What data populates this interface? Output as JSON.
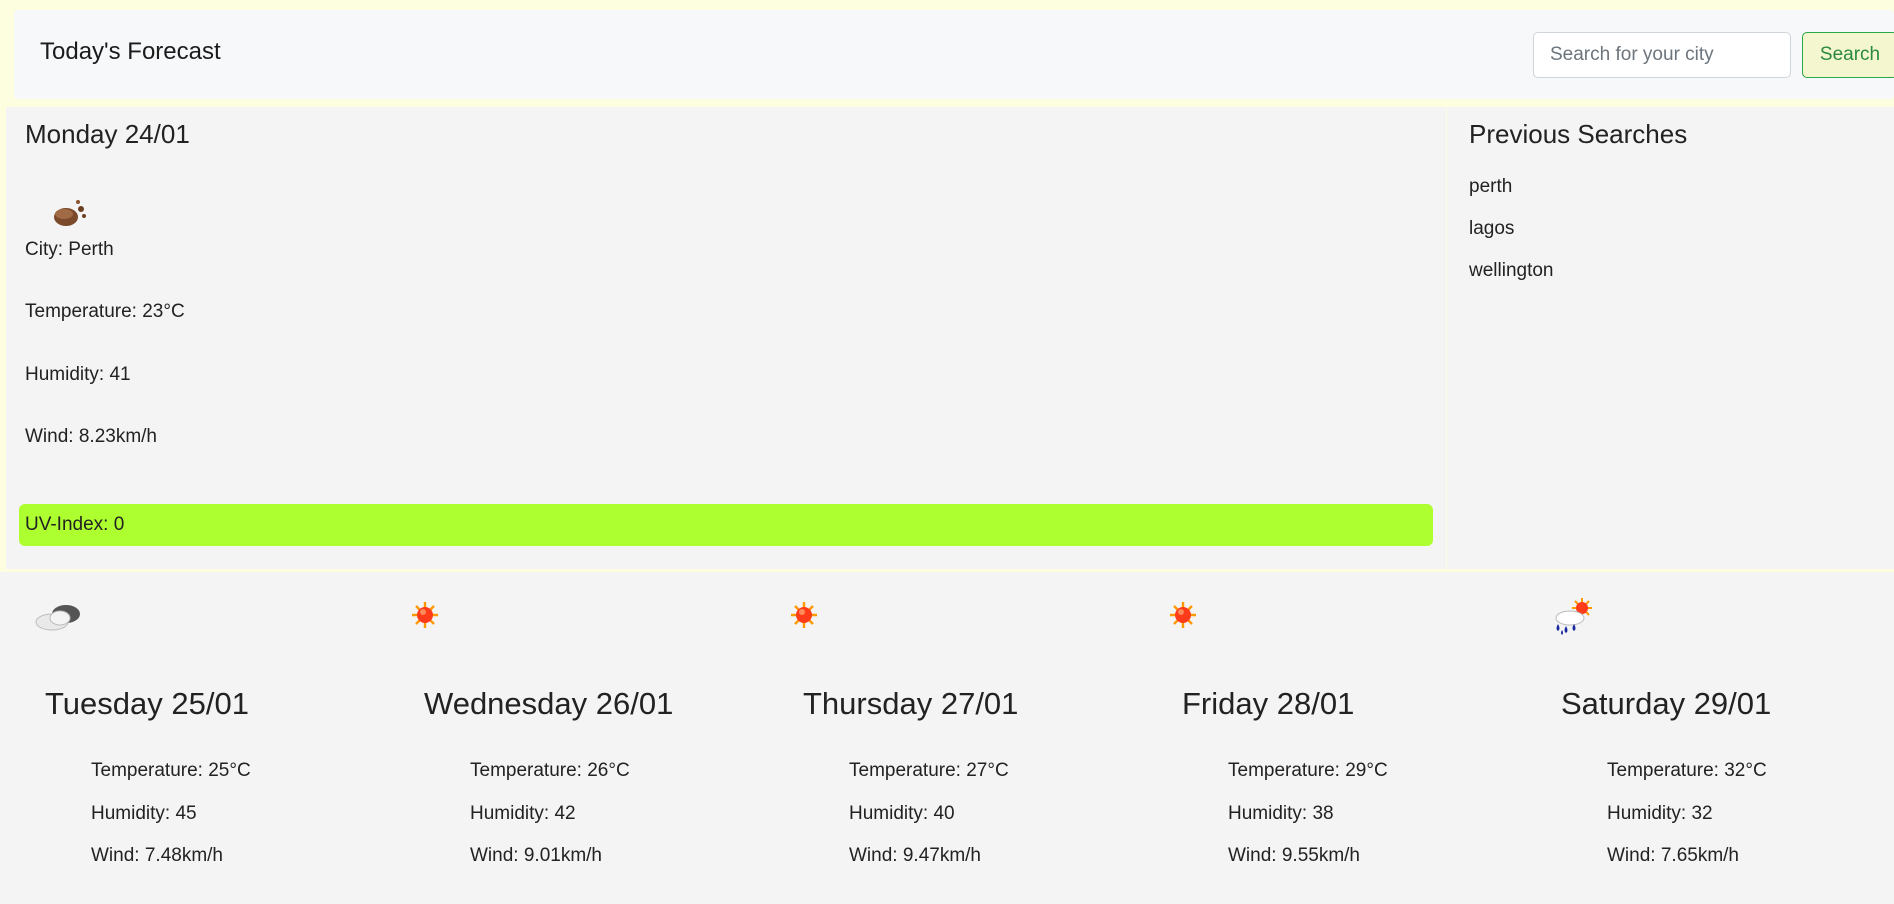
{
  "header": {
    "brand": "Today's Forecast",
    "search_placeholder": "Search for your city",
    "search_button": "Search"
  },
  "today": {
    "date": "Monday 24/01",
    "icon": "dust-weather-icon",
    "city": "City: Perth",
    "temperature": "Temperature: 23°C",
    "humidity": "Humidity: 41",
    "wind": "Wind: 8.23km/h",
    "uv": "UV-Index: 0",
    "uv_color": "#adff2f"
  },
  "previous": {
    "title": "Previous Searches",
    "items": [
      "perth",
      "lagos",
      "wellington"
    ]
  },
  "forecast": [
    {
      "day": "Tuesday 25/01",
      "icon": "cloudy-icon",
      "temperature": "Temperature: 25°C",
      "humidity": "Humidity: 45",
      "wind": "Wind: 7.48km/h"
    },
    {
      "day": "Wednesday 26/01",
      "icon": "sun-icon",
      "temperature": "Temperature: 26°C",
      "humidity": "Humidity: 42",
      "wind": "Wind: 9.01km/h"
    },
    {
      "day": "Thursday 27/01",
      "icon": "sun-icon",
      "temperature": "Temperature: 27°C",
      "humidity": "Humidity: 40",
      "wind": "Wind: 9.47km/h"
    },
    {
      "day": "Friday 28/01",
      "icon": "sun-icon",
      "temperature": "Temperature: 29°C",
      "humidity": "Humidity: 38",
      "wind": "Wind: 9.55km/h"
    },
    {
      "day": "Saturday 29/01",
      "icon": "rain-sun-icon",
      "temperature": "Temperature: 32°C",
      "humidity": "Humidity: 32",
      "wind": "Wind: 7.65km/h"
    }
  ]
}
